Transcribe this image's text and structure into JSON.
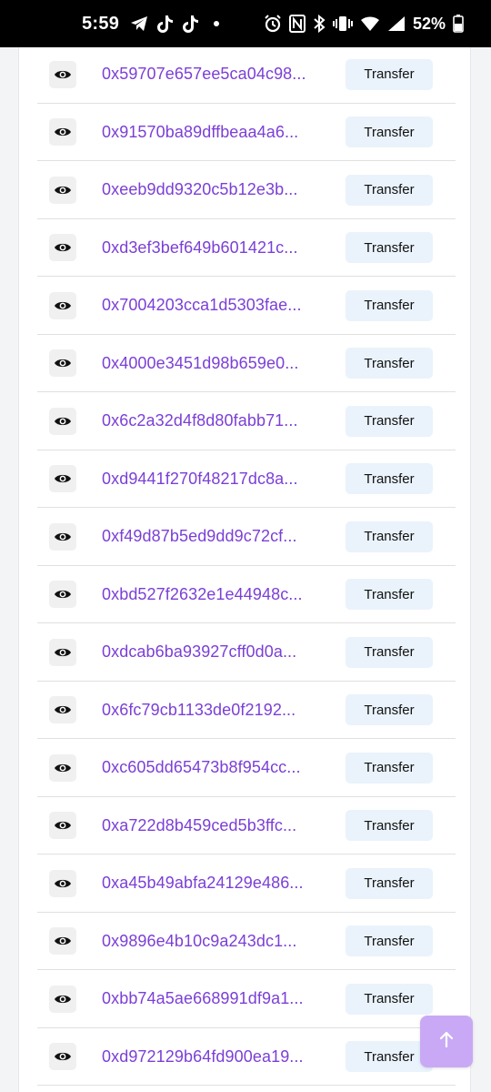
{
  "status_bar": {
    "time": "5:59",
    "battery_percent": "52%",
    "icons_left": [
      "telegram-icon",
      "tiktok-icon",
      "tiktok-icon",
      "dot-icon"
    ],
    "icons_right": [
      "alarm-icon",
      "nfc-icon",
      "bluetooth-icon",
      "vibrate-icon",
      "wifi-icon",
      "signal-icon",
      "battery-icon"
    ]
  },
  "list": {
    "button_label": "Transfer",
    "rows": [
      {
        "address": "0x59707e657ee5ca04c98..."
      },
      {
        "address": "0x91570ba89dffbeaa4a6..."
      },
      {
        "address": "0xeeb9dd9320c5b12e3b..."
      },
      {
        "address": "0xd3ef3bef649b601421c..."
      },
      {
        "address": "0x7004203cca1d5303fae..."
      },
      {
        "address": "0x4000e3451d98b659e0..."
      },
      {
        "address": "0x6c2a32d4f8d80fabb71..."
      },
      {
        "address": "0xd9441f270f48217dc8a..."
      },
      {
        "address": "0xf49d87b5ed9dd9c72cf..."
      },
      {
        "address": "0xbd527f2632e1e44948c..."
      },
      {
        "address": "0xdcab6ba93927cff0d0a..."
      },
      {
        "address": "0x6fc79cb1133de0f2192..."
      },
      {
        "address": "0xc605dd65473b8f954cc..."
      },
      {
        "address": "0xa722d8b459ced5b3ffc..."
      },
      {
        "address": "0xa45b49abfa24129e486..."
      },
      {
        "address": "0x9896e4b10c9a243dc1..."
      },
      {
        "address": "0xbb74a5ae668991df9a1..."
      },
      {
        "address": "0xd972129b64fd900ea19..."
      }
    ]
  },
  "colors": {
    "address_text": "#7b3fd6",
    "transfer_button_bg": "#eaf3fb",
    "scroll_top_button_bg": "#c9a9f5"
  },
  "scroll_top_button": {
    "icon": "arrow-up-icon"
  }
}
